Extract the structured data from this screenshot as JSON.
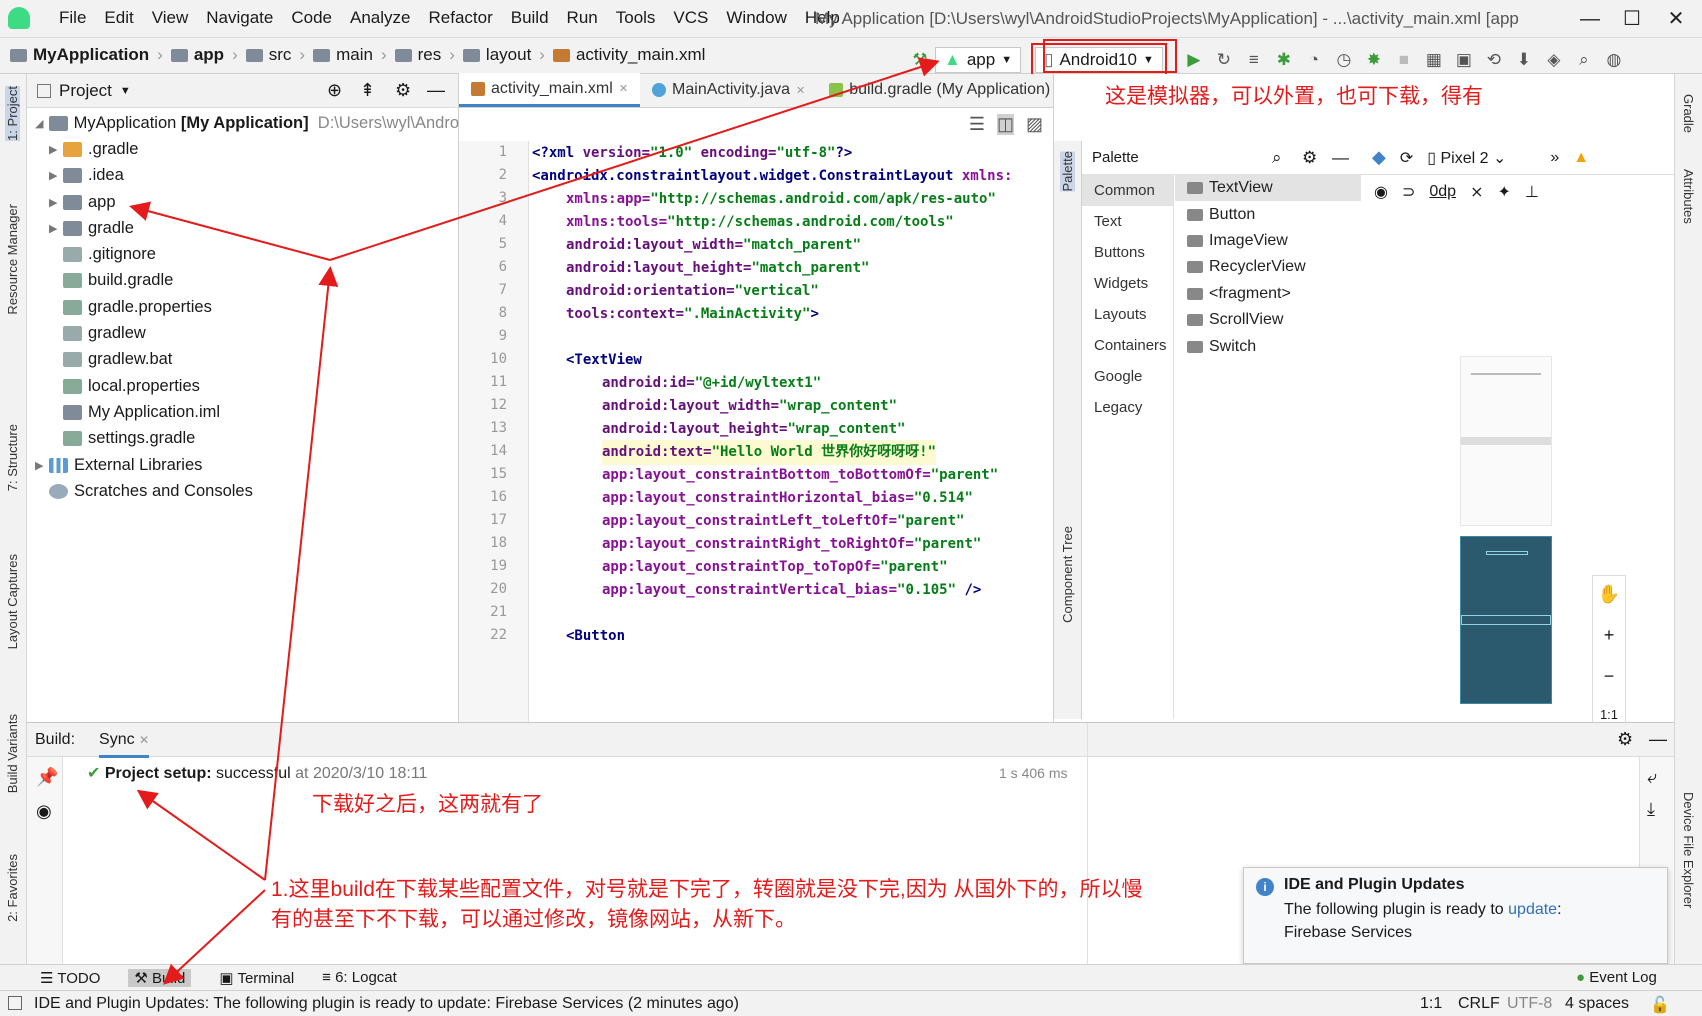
{
  "app": {
    "menus": [
      "File",
      "Edit",
      "View",
      "Navigate",
      "Code",
      "Analyze",
      "Refactor",
      "Build",
      "Run",
      "Tools",
      "VCS",
      "Window",
      "Help"
    ],
    "title": "My Application [D:\\Users\\wyl\\AndroidStudioProjects\\MyApplication] - ...\\activity_main.xml [app"
  },
  "nav": {
    "crumbs": [
      "MyApplication",
      "app",
      "src",
      "main",
      "res",
      "layout",
      "activity_main.xml"
    ],
    "run_config": "app",
    "device": "Android10"
  },
  "left_strip": [
    "1: Project",
    "Resource Manager",
    "7: Structure",
    "Layout Captures",
    "Build Variants",
    "2: Favorites"
  ],
  "right_strip": [
    "Gradle",
    "Attributes",
    "Device File Explorer"
  ],
  "project": {
    "title": "Project",
    "root": "MyApplication",
    "root_bold": "[My Application]",
    "root_path": "D:\\Users\\wyl\\Andro",
    "items": [
      ".gradle",
      ".idea",
      "app",
      "gradle",
      ".gitignore",
      "build.gradle",
      "gradle.properties",
      "gradlew",
      "gradlew.bat",
      "local.properties",
      "My Application.iml",
      "settings.gradle"
    ],
    "external": "External Libraries",
    "scratches": "Scratches and Consoles"
  },
  "editor": {
    "tabs": [
      "activity_main.xml",
      "MainActivity.java",
      "build.gradle (My Application)"
    ],
    "line_numbers": [
      "1",
      "2",
      "3",
      "4",
      "5",
      "6",
      "7",
      "8",
      "9",
      "10",
      "11",
      "12",
      "13",
      "14",
      "15",
      "16",
      "17",
      "18",
      "19",
      "20",
      "21",
      "22"
    ]
  },
  "palette": {
    "title": "Palette",
    "categories": [
      "Common",
      "Text",
      "Buttons",
      "Widgets",
      "Layouts",
      "Containers",
      "Google",
      "Legacy"
    ],
    "items": [
      "TextView",
      "Button",
      "ImageView",
      "RecyclerView",
      "<fragment>",
      "ScrollView",
      "Switch"
    ],
    "side_label": "Palette",
    "tree_label": "Component Tree"
  },
  "preview": {
    "device": "Pixel 2",
    "dp": "0dp",
    "zoom": "1:1"
  },
  "build": {
    "label": "Build:",
    "tab": "Sync",
    "status_bold": "Project setup:",
    "status": "successful",
    "time": "at 2020/3/10 18:11",
    "duration": "1 s 406 ms"
  },
  "annotations": {
    "emulator": "这是模拟器，可以外置，也可下载，得有",
    "done": "下载好之后，这两就有了",
    "explain1": "1.这里build在下载某些配置文件，对号就是下完了，转圈就是没下完,因为 从国外下的，所以慢",
    "explain2": "有的甚至下不下载，可以通过修改，镜像网站，从新下。"
  },
  "notification": {
    "title": "IDE and Plugin Updates",
    "text": "The following plugin is ready to",
    "link": "update",
    "suffix": ":",
    "plugin": "Firebase Services"
  },
  "bottom_tabs": [
    "TODO",
    "Build",
    "Terminal",
    "6: Logcat"
  ],
  "event_log": "Event Log",
  "status": {
    "message": "IDE and Plugin Updates: The following plugin is ready to update: Firebase Services (2 minutes ago)",
    "pos": "1:1",
    "crlf": "CRLF",
    "enc": "UTF-8",
    "indent": "4 spaces"
  },
  "colors": {
    "accent": "#4083c9",
    "annotation": "#e31b1b",
    "success": "#3c9c3c"
  }
}
